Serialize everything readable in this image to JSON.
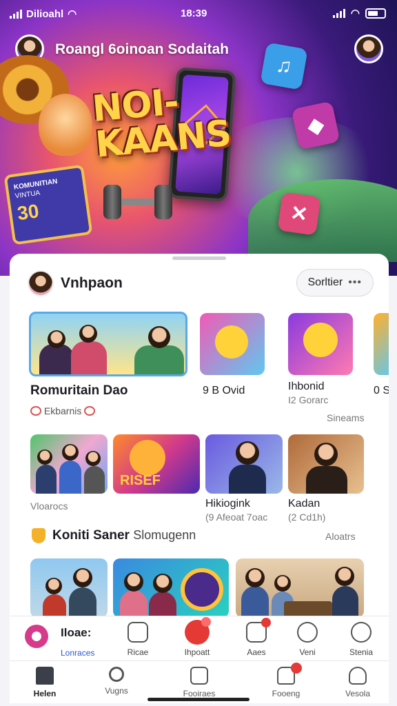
{
  "status_bar": {
    "carrier": "Dilioahl",
    "time": "18:39"
  },
  "hero": {
    "title": "Roangl 6oinoan Sodaitah",
    "logo": "NOI- KAANS",
    "card": {
      "line1": "KOMUNITIAN",
      "line2": "VINTUA",
      "value": "30"
    }
  },
  "sheet": {
    "title": "Vnhpaon",
    "sort_label": "Sorltier",
    "row1": {
      "items": [
        {
          "title": "Romuritain Dao",
          "meta": "Ekbarnis"
        },
        {
          "title": "9 B Ovid"
        },
        {
          "title": "Ihbonid",
          "subtitle": "I2 Gorarc"
        },
        {
          "title": "0 S"
        }
      ],
      "see_all": "Sineams"
    },
    "row2": {
      "items": [
        {
          "caption": "Vloarocs"
        },
        {
          "caption": "RISEF"
        },
        {
          "title": "Hikiogink",
          "subtitle": "(9 Afeoat 7oac"
        },
        {
          "title": "Kadan",
          "subtitle": "(2 Cd1h)"
        }
      ]
    },
    "section": {
      "title": "Koniti Saner",
      "subtitle": "Slomugenn",
      "link": "Aloatrs"
    }
  },
  "action_row": [
    {
      "label": "Lonraces",
      "title": "Iloae:"
    },
    {
      "label": "Ricae"
    },
    {
      "label": "Ihpoatt"
    },
    {
      "label": "Aaes"
    },
    {
      "label": "Veni"
    },
    {
      "label": "Stenia"
    }
  ],
  "bottom_nav": [
    {
      "label": "Helen",
      "icon": "home-icon"
    },
    {
      "label": "Vugns",
      "icon": "search-icon"
    },
    {
      "label": "Fooiraes",
      "icon": "smiley-icon"
    },
    {
      "label": "Fooeng",
      "icon": "notifications-icon"
    },
    {
      "label": "Vesola",
      "icon": "profile-icon"
    }
  ],
  "colors": {
    "accent": "#e53935",
    "brand_purple": "#6c2bd9",
    "sheet_bg": "#ffffff"
  }
}
